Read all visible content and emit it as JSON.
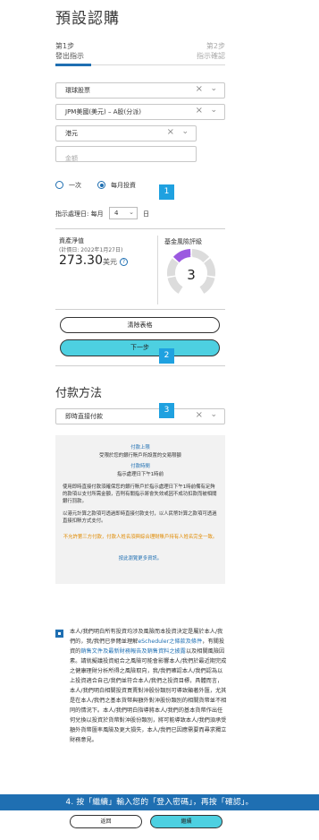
{
  "page_title": "預設認購",
  "steps": {
    "step1_num": "第1步",
    "step1_label": "發出指示",
    "step2_num": "第2步",
    "step2_label": "指示確認"
  },
  "form": {
    "market": "環球股票",
    "fund": "JPM美國(美元) – A股(分派)",
    "currency": "港元",
    "amount_placeholder": "金額"
  },
  "frequency": {
    "one_time": "一次",
    "monthly": "每月投資",
    "selected": "monthly"
  },
  "processing": {
    "label": "指示處理日: 每月",
    "day": "4",
    "suffix": "日"
  },
  "nav": {
    "label": "資產淨值",
    "date": "(計價日: 2022年1月27日)",
    "value": "273.30",
    "unit": "美元"
  },
  "risk": {
    "label": "基金風險評級",
    "rating": "3",
    "rating_small": "3",
    "active_segment": 3,
    "segment_count": 6,
    "active_color": "#9b59e0",
    "inactive_color": "#dcdcdc"
  },
  "buttons": {
    "clear": "清除表格",
    "next": "下一步",
    "back": "返回",
    "continue": "繼續"
  },
  "badges": [
    "1",
    "2",
    "3"
  ],
  "payment": {
    "title": "付款方法",
    "method": "即時直接付款"
  },
  "info_box": {
    "h1": "付款上限",
    "l1": "受限於您的銀行賬戶所設置的交易限額",
    "h2": "付款時間",
    "l2": "指示處理日下午1時前",
    "p1": "使用即時直接付款須確保您的銀行賬戶於指示處理日下午1時前備有足夠的款項以支付所需金額，否則有關指示將會失效或因不成功扣款而被相關銀行罰款。",
    "p2": "以港元計算之款項可透過即時直接付款支付，以人民幣計算之款項可透過直接扣賬方式支付。",
    "warning": "不允許第三方付款，付款人姓名須與綜合理財賬戶持有人姓名完全一致。",
    "footer": "按此瀏覽更多資訊。"
  },
  "consent": {
    "p1": "本人/我們明白所有投資均涉及風險而本投資決定是屬於本人/我們的，我/我們已參閱並理解",
    "link1": "eScheduler之條款及條件",
    "p2": "，有關投資的",
    "link2": "銷售文件及最新財務報告及銷售資料之披露",
    "p3": "以及相關風險因素。請就擬議投資組合之風險可能會影響本人/我們於最近期完成之健康理財分析所得之風險取向，我/我們確認本人/我們認為以上投資適合自己/我們並符合本人/我們之投資目標，具體而言，本人/我們明白相關投資買賣對沖股份類別可導致顯著外匯，尤其是在本人/我們之基本貨幣與額外對沖股份類別的相關貨幣並不相同的情況下。本人/我們明白指導將本人/我們的基本貨幣作出任何兌換以投資於貨幣對沖股份類別，將可能導致本人/我們須承受額外貨幣匯率風險及更大損失，本人/我們已因應需要而尋求獨立財務意見。"
  },
  "banner": "4. 按「繼續」輸入您的「登入密碼」，再按「確認」。"
}
